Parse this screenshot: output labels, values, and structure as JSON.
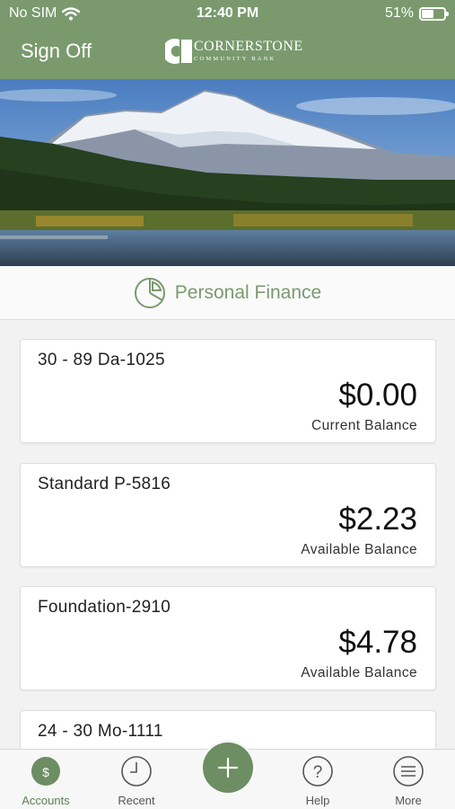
{
  "status_bar": {
    "carrier": "No SIM",
    "time": "12:40 PM",
    "battery": "51%"
  },
  "nav": {
    "sign_off_label": "Sign Off",
    "logo_name": "CORNERSTONE",
    "logo_sub": "COMMUNITY BANK"
  },
  "section": {
    "title": "Personal Finance",
    "icon": "pie-chart-icon"
  },
  "accounts": [
    {
      "name": "30 - 89 Da-1025",
      "amount": "$0.00",
      "balance_label": "Current Balance"
    },
    {
      "name": "Standard P-5816",
      "amount": "$2.23",
      "balance_label": "Available Balance"
    },
    {
      "name": "Foundation-2910",
      "amount": "$4.78",
      "balance_label": "Available Balance"
    },
    {
      "name": "24 - 30 Mo-1111"
    }
  ],
  "tabs": [
    {
      "label": "Accounts",
      "icon": "dollar-coin-icon",
      "active": true
    },
    {
      "label": "Recent",
      "icon": "clock-icon"
    },
    {
      "label": "Help",
      "icon": "question-icon"
    },
    {
      "label": "More",
      "icon": "menu-icon"
    }
  ],
  "fab_icon": "plus-icon",
  "colors": {
    "brand": "#7a9a6e",
    "fab": "#6d8d62"
  }
}
